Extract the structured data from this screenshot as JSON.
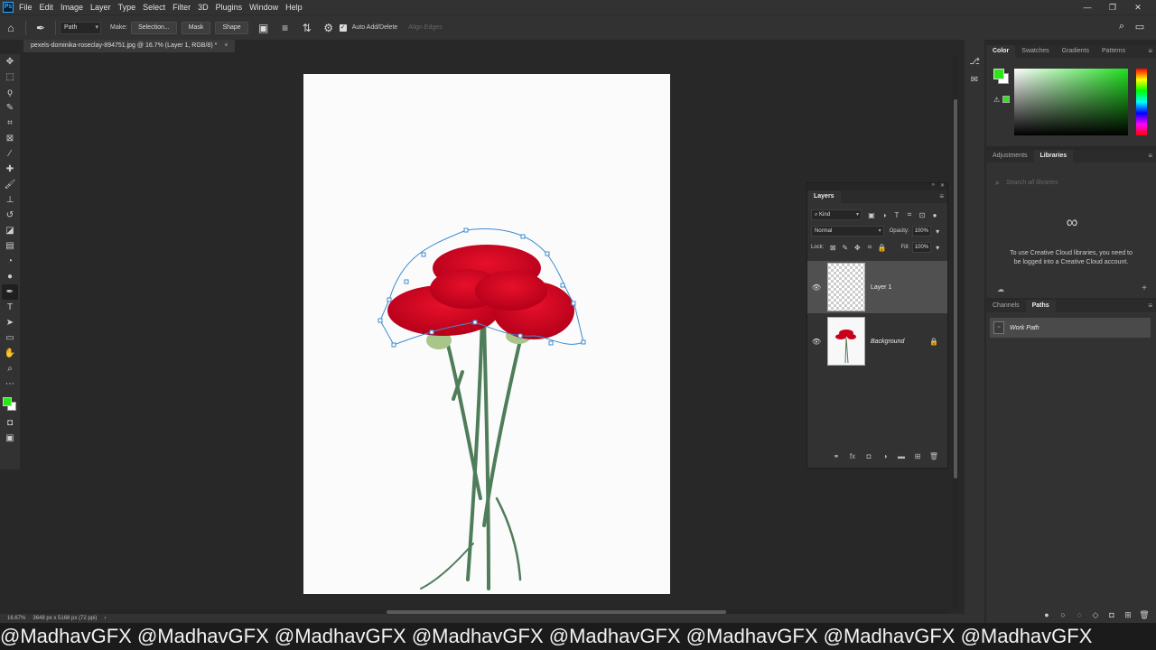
{
  "menubar": {
    "logo": "Ps",
    "items": [
      "File",
      "Edit",
      "Image",
      "Layer",
      "Type",
      "Select",
      "Filter",
      "3D",
      "Plugins",
      "Window",
      "Help"
    ],
    "window_controls": [
      "—",
      "❐",
      "✕"
    ]
  },
  "options": {
    "mode_value": "Path",
    "make_label": "Make:",
    "selection_button": "Selection...",
    "mask_button": "Mask",
    "shape_button": "Shape",
    "auto_add_delete": "Auto Add/Delete",
    "align_edges": "Align Edges"
  },
  "document": {
    "tab_title": "pexels-dominika-roseclay-894751.jpg @ 16.7% (Layer 1, RGB/8) *",
    "tab_close": "×"
  },
  "status": {
    "zoom": "16.67%",
    "dimensions": "3648 px x 5168 px (72 ppi)",
    "arrow": "›"
  },
  "color_panel": {
    "tabs": [
      "Color",
      "Swatches",
      "Gradients",
      "Patterns"
    ],
    "foreground": "#2ee51a",
    "background": "#ffffff"
  },
  "libraries_panel": {
    "tabs": [
      "Adjustments",
      "Libraries"
    ],
    "search_placeholder": "Search all libraries",
    "message": "To use Creative Cloud libraries, you need to be logged into a Creative Cloud account."
  },
  "paths_panel": {
    "tabs": [
      "Channels",
      "Paths"
    ],
    "path_name": "Work Path"
  },
  "layers_panel": {
    "title": "Layers",
    "kind_filter": "Kind",
    "blend_mode": "Normal",
    "opacity_label": "Opacity:",
    "opacity_value": "100%",
    "lock_label": "Lock:",
    "fill_label": "Fill:",
    "fill_value": "100%",
    "layers": [
      {
        "name": "Layer 1",
        "selected": true
      },
      {
        "name": "Background",
        "selected": false,
        "locked": true
      }
    ]
  },
  "watermark": {
    "text": "@MadhavGFX @MadhavGFX @MadhavGFX @MadhavGFX @MadhavGFX @MadhavGFX @MadhavGFX @MadhavGFX"
  }
}
